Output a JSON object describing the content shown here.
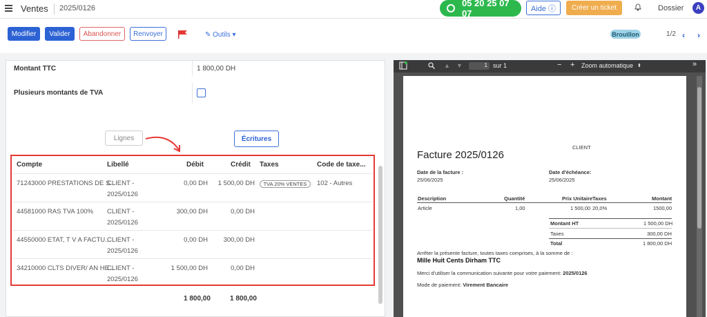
{
  "topbar": {
    "app_title": "Ventes",
    "breadcrumb": "2025/0126",
    "phone": "05 20 25 07 07",
    "aide": "Aide ⓘ",
    "ticket": "Créer un ticket",
    "dossier": "Dossier",
    "avatar": "A"
  },
  "actions": {
    "modifier": "Modifier",
    "valider": "Valider",
    "abandonner": "Abandonner",
    "renvoyer": "Renvoyer",
    "outils": "✎ Outils ▾",
    "status": "Brouillon",
    "pager": "1/2"
  },
  "form": {
    "montant_ttc_label": "Montant TTC",
    "montant_ttc_value": "1 800,00 DH",
    "plusieurs_tva_label": "Plusieurs montants de TVA",
    "lignes_tab": "Lignes",
    "ecritures_tab": "Écritures"
  },
  "table": {
    "headers": [
      "Compte",
      "Libellé",
      "Débit",
      "Crédit",
      "Taxes",
      "Code de taxe..."
    ],
    "rows": [
      {
        "compte": "71243000 PRESTATIONS DE S...",
        "libelle1": "CLIENT -",
        "libelle2": "2025/0126",
        "debit": "0,00 DH",
        "credit": "1 500,00 DH",
        "taxes": "TVA 20% VENTES",
        "code": "102 - Autres"
      },
      {
        "compte": "44581000 RAS TVA 100%",
        "libelle1": "CLIENT -",
        "libelle2": "2025/0126",
        "debit": "300,00 DH",
        "credit": "0,00 DH",
        "taxes": "",
        "code": ""
      },
      {
        "compte": "44550000 ETAT, T V A FACTU...",
        "libelle1": "CLIENT -",
        "libelle2": "2025/0126",
        "debit": "0,00 DH",
        "credit": "300,00 DH",
        "taxes": "",
        "code": ""
      },
      {
        "compte": "34210000 CLTS DIVER/ AN HE...",
        "libelle1": "CLIENT -",
        "libelle2": "2025/0126",
        "debit": "1 500,00 DH",
        "credit": "0,00 DH",
        "taxes": "",
        "code": ""
      }
    ],
    "total_debit": "1 800,00",
    "total_credit": "1 800,00"
  },
  "pdf": {
    "page_current": "1",
    "page_total": "sur 1",
    "zoom": "Zoom automatique",
    "client": "CLIENT",
    "title": "Facture 2025/0126",
    "date_facture_label": "Date de la facture :",
    "date_facture": "25/06/2025",
    "date_echeance_label": "Date d'échéance:",
    "date_echeance": "25/06/2025",
    "col_description": "Description",
    "col_quantite": "Quantité",
    "col_prix": "Prix Unitaire",
    "col_taxes": "Taxes",
    "col_montant": "Montant",
    "item_desc": "Article",
    "item_qty": "1,00",
    "item_prix": "1 500,00",
    "item_tax": "20,0%",
    "item_montant": "1500,00",
    "montant_ht_label": "Montant HT",
    "montant_ht": "1 500,00 DH",
    "taxes_label": "Taxes",
    "taxes": "300,00 DH",
    "total_label": "Total",
    "total": "1 800,00 DH",
    "arret_text": "Arrêter la présente facture, toutes taxes comprises, à la somme de :",
    "amount_words": "Mille Huit Cents Dirham TTC",
    "merci_text": "Merci d'utiliser la communication suivante pour votre paiement:",
    "merci_ref": "2025/0126",
    "mode_label": "Mode de paiement:",
    "mode_value": "Virement Bancaire"
  }
}
